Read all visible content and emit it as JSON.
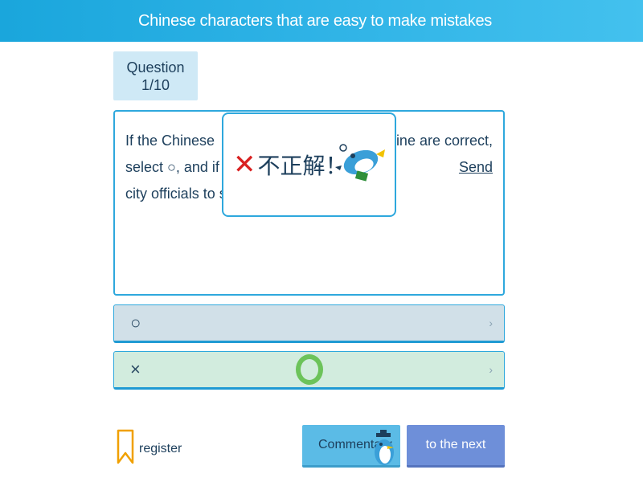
{
  "header": {
    "title": "Chinese characters that are easy to make mistakes"
  },
  "question_badge": {
    "label": "Question",
    "count": "1/10"
  },
  "question": {
    "line1_left": "If the Chinese",
    "line1_right": "ine are correct,",
    "line2_left": "select ○, and if t",
    "line2_link": "Send",
    "line3_left": "city officials to s"
  },
  "result_popup": {
    "mark": "✕",
    "text": "不正解！",
    "mascot_icon": "penguin-fallen-icon"
  },
  "choices": [
    {
      "symbol": "○",
      "chevron": "›"
    },
    {
      "symbol": "×",
      "chevron": "›"
    }
  ],
  "correct_marker": {
    "icon": "green-ring-icon",
    "color": "#6cc35a"
  },
  "footer": {
    "register_label": "register",
    "commentary_label": "Commentary",
    "next_label": "to the next"
  },
  "colors": {
    "header": "#2fb3e6",
    "accent": "#2ea8dd",
    "wrong": "#d92121",
    "next_button": "#6e8fd9"
  }
}
